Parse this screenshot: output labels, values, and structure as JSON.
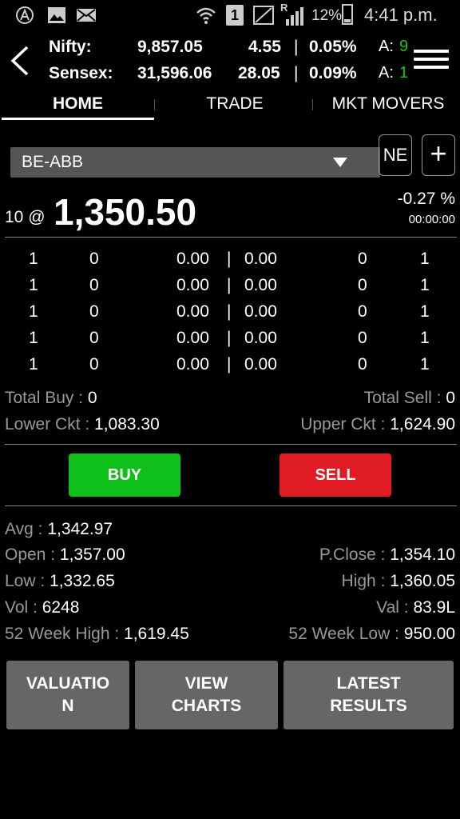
{
  "status_bar": {
    "battery": "12%",
    "time": "4:41 p.m.",
    "sim_slot": "1",
    "roaming": "R",
    "icons": [
      "assistant-icon",
      "image-icon",
      "mail-icon",
      "wifi-icon",
      "sim-icon",
      "no-signal-icon",
      "signal-icon",
      "battery-icon"
    ]
  },
  "ticker": {
    "rows": [
      {
        "name": "Nifty:",
        "value": "9,857.05",
        "change": "4.55",
        "sep": "|",
        "pct": "0.05%",
        "extra_label": "A:",
        "extra_value": "9"
      },
      {
        "name": "Sensex:",
        "value": "31,596.06",
        "change": "28.05",
        "sep": "|",
        "pct": "0.09%",
        "extra_label": "A:",
        "extra_value": "1"
      }
    ]
  },
  "tabs": [
    "HOME",
    "TRADE",
    "MKT MOVERS"
  ],
  "active_tab": "HOME",
  "scrip": {
    "selected": "BE-ABB",
    "ne_label": "NE",
    "add_label": "+"
  },
  "quote": {
    "qty_prefix": "10 @",
    "ltp": "1,350.50",
    "change_pct": "-0.27 %",
    "time": "00:00:00"
  },
  "depth": [
    {
      "bid_orders": "1",
      "bid_qty": "0",
      "bid_price": "0.00",
      "sep": "|",
      "ask_price": "0.00",
      "ask_qty": "0",
      "ask_orders": "1"
    },
    {
      "bid_orders": "1",
      "bid_qty": "0",
      "bid_price": "0.00",
      "sep": "|",
      "ask_price": "0.00",
      "ask_qty": "0",
      "ask_orders": "1"
    },
    {
      "bid_orders": "1",
      "bid_qty": "0",
      "bid_price": "0.00",
      "sep": "|",
      "ask_price": "0.00",
      "ask_qty": "0",
      "ask_orders": "1"
    },
    {
      "bid_orders": "1",
      "bid_qty": "0",
      "bid_price": "0.00",
      "sep": "|",
      "ask_price": "0.00",
      "ask_qty": "0",
      "ask_orders": "1"
    },
    {
      "bid_orders": "1",
      "bid_qty": "0",
      "bid_price": "0.00",
      "sep": "|",
      "ask_price": "0.00",
      "ask_qty": "0",
      "ask_orders": "1"
    }
  ],
  "totals": {
    "total_buy_label": "Total Buy : ",
    "total_buy": "0",
    "total_sell_label": "Total Sell : ",
    "total_sell": "0",
    "lower_ckt_label": "Lower Ckt : ",
    "lower_ckt": "1,083.30",
    "upper_ckt_label": "Upper Ckt : ",
    "upper_ckt": "1,624.90"
  },
  "actions": {
    "buy": "BUY",
    "sell": "SELL",
    "buy_color": "#0fbf1a",
    "sell_color": "#e01b24"
  },
  "stats": {
    "avg_label": "Avg : ",
    "avg": "1,342.97",
    "open_label": "Open : ",
    "open": "1,357.00",
    "pclose_label": "P.Close : ",
    "pclose": "1,354.10",
    "low_label": "Low : ",
    "low": "1,332.65",
    "high_label": "High : ",
    "high": "1,360.05",
    "vol_label": "Vol : ",
    "vol": "6248",
    "val_label": "Val : ",
    "val": "83.9L",
    "wk52_high_label": "52 Week High : ",
    "wk52_high": "1,619.45",
    "wk52_low_label": "52 Week Low : ",
    "wk52_low": "950.00"
  },
  "bottom_buttons": {
    "valuation_1": "VALUATIO",
    "valuation_2": "N",
    "charts_1": "VIEW",
    "charts_2": "CHARTS",
    "results_1": "LATEST",
    "results_2": "RESULTS"
  }
}
